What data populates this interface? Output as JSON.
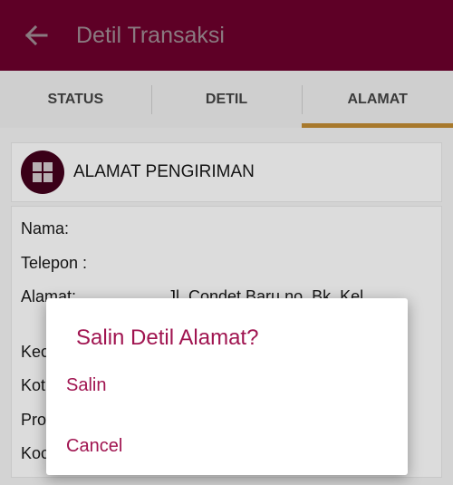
{
  "appbar": {
    "title": "Detil Transaksi",
    "back_icon": "arrow-left-icon"
  },
  "tabs": [
    {
      "label": "STATUS",
      "active": false
    },
    {
      "label": "DETIL",
      "active": false
    },
    {
      "label": "ALAMAT",
      "active": true
    }
  ],
  "section": {
    "icon": "grid-icon",
    "title": "ALAMAT PENGIRIMAN"
  },
  "details": {
    "nama_label": "Nama:",
    "telepon_label": "Telepon :",
    "alamat_label": "Alamat:",
    "alamat_value": "Jl. Condet Baru no. Bk, Kel.",
    "kecamatan_label_partial": "Kec",
    "kota_label_partial": "Kot",
    "provinsi_label_partial": "Pro",
    "kodepos_label_partial": "Koc"
  },
  "dialog": {
    "title": "Salin Detil Alamat?",
    "option_copy": "Salin",
    "option_cancel": "Cancel"
  },
  "colors": {
    "appbar": "#5e0026",
    "accent": "#a01450",
    "tab_indicator": "#a8792c"
  }
}
